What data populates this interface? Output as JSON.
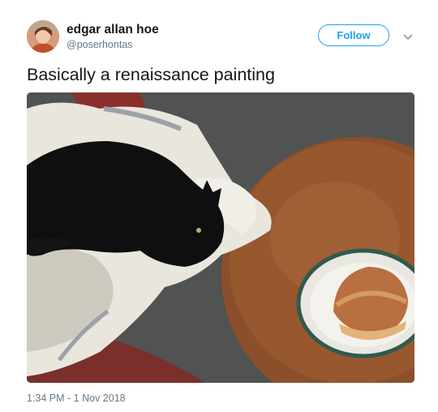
{
  "user": {
    "display_name": "edgar allan hoe",
    "handle": "@poserhontas",
    "avatar_icon": "profile-photo"
  },
  "actions": {
    "follow_label": "Follow",
    "more_icon": "chevron-down-icon"
  },
  "tweet": {
    "text": "Basically a renaissance painting",
    "timestamp": "1:34 PM - 1 Nov 2018"
  },
  "photo": {
    "subject": "black cat on fleece blanket next to a burger on a plate"
  },
  "colors": {
    "accent": "#1da1f2",
    "secondary_text": "#657786",
    "primary_text": "#14171a"
  }
}
